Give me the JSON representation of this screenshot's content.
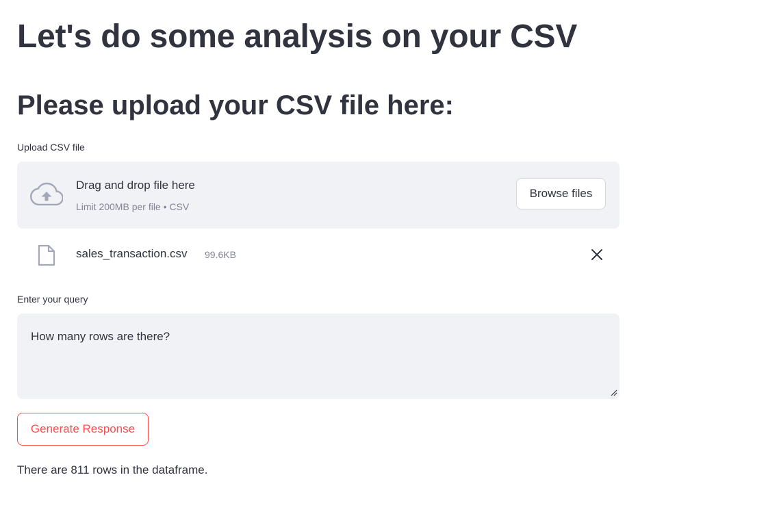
{
  "page": {
    "title": "Let's do some analysis on your CSV",
    "subtitle": "Please upload your CSV file here:"
  },
  "uploader": {
    "label": "Upload CSV file",
    "drop_title": "Drag and drop file here",
    "drop_subtitle": "Limit 200MB per file • CSV",
    "browse_label": "Browse files",
    "icon": "cloud-upload-icon"
  },
  "uploaded_file": {
    "name": "sales_transaction.csv",
    "size": "99.6KB",
    "icon": "file-icon",
    "remove_icon": "close-icon"
  },
  "query": {
    "label": "Enter your query",
    "value": "How many rows are there?"
  },
  "generate_button": {
    "label": "Generate Response"
  },
  "response": {
    "text": "There are 811 rows in the dataframe."
  },
  "colors": {
    "text": "#31333f",
    "muted": "#808495",
    "panel_bg": "#f0f2f6",
    "accent": "#ff4b4b"
  }
}
